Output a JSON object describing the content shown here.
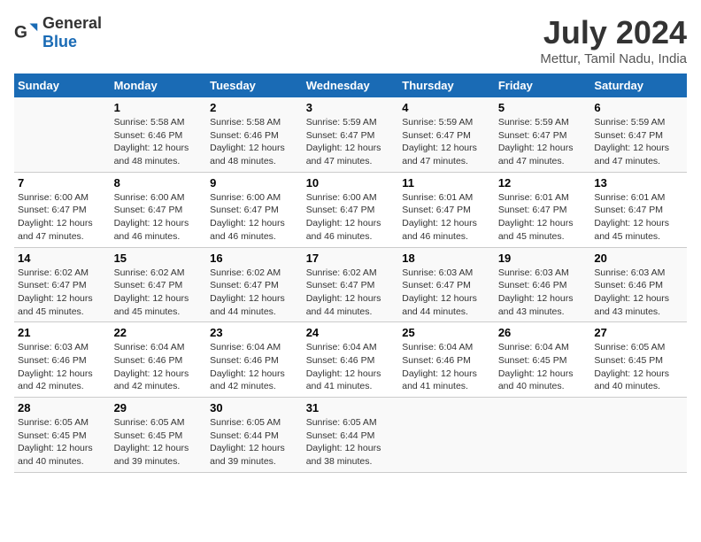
{
  "header": {
    "logo_general": "General",
    "logo_blue": "Blue",
    "month_title": "July 2024",
    "location": "Mettur, Tamil Nadu, India"
  },
  "days_of_week": [
    "Sunday",
    "Monday",
    "Tuesday",
    "Wednesday",
    "Thursday",
    "Friday",
    "Saturday"
  ],
  "weeks": [
    [
      {
        "day": "",
        "info": ""
      },
      {
        "day": "1",
        "info": "Sunrise: 5:58 AM\nSunset: 6:46 PM\nDaylight: 12 hours\nand 48 minutes."
      },
      {
        "day": "2",
        "info": "Sunrise: 5:58 AM\nSunset: 6:46 PM\nDaylight: 12 hours\nand 48 minutes."
      },
      {
        "day": "3",
        "info": "Sunrise: 5:59 AM\nSunset: 6:47 PM\nDaylight: 12 hours\nand 47 minutes."
      },
      {
        "day": "4",
        "info": "Sunrise: 5:59 AM\nSunset: 6:47 PM\nDaylight: 12 hours\nand 47 minutes."
      },
      {
        "day": "5",
        "info": "Sunrise: 5:59 AM\nSunset: 6:47 PM\nDaylight: 12 hours\nand 47 minutes."
      },
      {
        "day": "6",
        "info": "Sunrise: 5:59 AM\nSunset: 6:47 PM\nDaylight: 12 hours\nand 47 minutes."
      }
    ],
    [
      {
        "day": "7",
        "info": "Sunrise: 6:00 AM\nSunset: 6:47 PM\nDaylight: 12 hours\nand 47 minutes."
      },
      {
        "day": "8",
        "info": "Sunrise: 6:00 AM\nSunset: 6:47 PM\nDaylight: 12 hours\nand 46 minutes."
      },
      {
        "day": "9",
        "info": "Sunrise: 6:00 AM\nSunset: 6:47 PM\nDaylight: 12 hours\nand 46 minutes."
      },
      {
        "day": "10",
        "info": "Sunrise: 6:00 AM\nSunset: 6:47 PM\nDaylight: 12 hours\nand 46 minutes."
      },
      {
        "day": "11",
        "info": "Sunrise: 6:01 AM\nSunset: 6:47 PM\nDaylight: 12 hours\nand 46 minutes."
      },
      {
        "day": "12",
        "info": "Sunrise: 6:01 AM\nSunset: 6:47 PM\nDaylight: 12 hours\nand 45 minutes."
      },
      {
        "day": "13",
        "info": "Sunrise: 6:01 AM\nSunset: 6:47 PM\nDaylight: 12 hours\nand 45 minutes."
      }
    ],
    [
      {
        "day": "14",
        "info": "Sunrise: 6:02 AM\nSunset: 6:47 PM\nDaylight: 12 hours\nand 45 minutes."
      },
      {
        "day": "15",
        "info": "Sunrise: 6:02 AM\nSunset: 6:47 PM\nDaylight: 12 hours\nand 45 minutes."
      },
      {
        "day": "16",
        "info": "Sunrise: 6:02 AM\nSunset: 6:47 PM\nDaylight: 12 hours\nand 44 minutes."
      },
      {
        "day": "17",
        "info": "Sunrise: 6:02 AM\nSunset: 6:47 PM\nDaylight: 12 hours\nand 44 minutes."
      },
      {
        "day": "18",
        "info": "Sunrise: 6:03 AM\nSunset: 6:47 PM\nDaylight: 12 hours\nand 44 minutes."
      },
      {
        "day": "19",
        "info": "Sunrise: 6:03 AM\nSunset: 6:46 PM\nDaylight: 12 hours\nand 43 minutes."
      },
      {
        "day": "20",
        "info": "Sunrise: 6:03 AM\nSunset: 6:46 PM\nDaylight: 12 hours\nand 43 minutes."
      }
    ],
    [
      {
        "day": "21",
        "info": "Sunrise: 6:03 AM\nSunset: 6:46 PM\nDaylight: 12 hours\nand 42 minutes."
      },
      {
        "day": "22",
        "info": "Sunrise: 6:04 AM\nSunset: 6:46 PM\nDaylight: 12 hours\nand 42 minutes."
      },
      {
        "day": "23",
        "info": "Sunrise: 6:04 AM\nSunset: 6:46 PM\nDaylight: 12 hours\nand 42 minutes."
      },
      {
        "day": "24",
        "info": "Sunrise: 6:04 AM\nSunset: 6:46 PM\nDaylight: 12 hours\nand 41 minutes."
      },
      {
        "day": "25",
        "info": "Sunrise: 6:04 AM\nSunset: 6:46 PM\nDaylight: 12 hours\nand 41 minutes."
      },
      {
        "day": "26",
        "info": "Sunrise: 6:04 AM\nSunset: 6:45 PM\nDaylight: 12 hours\nand 40 minutes."
      },
      {
        "day": "27",
        "info": "Sunrise: 6:05 AM\nSunset: 6:45 PM\nDaylight: 12 hours\nand 40 minutes."
      }
    ],
    [
      {
        "day": "28",
        "info": "Sunrise: 6:05 AM\nSunset: 6:45 PM\nDaylight: 12 hours\nand 40 minutes."
      },
      {
        "day": "29",
        "info": "Sunrise: 6:05 AM\nSunset: 6:45 PM\nDaylight: 12 hours\nand 39 minutes."
      },
      {
        "day": "30",
        "info": "Sunrise: 6:05 AM\nSunset: 6:44 PM\nDaylight: 12 hours\nand 39 minutes."
      },
      {
        "day": "31",
        "info": "Sunrise: 6:05 AM\nSunset: 6:44 PM\nDaylight: 12 hours\nand 38 minutes."
      },
      {
        "day": "",
        "info": ""
      },
      {
        "day": "",
        "info": ""
      },
      {
        "day": "",
        "info": ""
      }
    ]
  ]
}
